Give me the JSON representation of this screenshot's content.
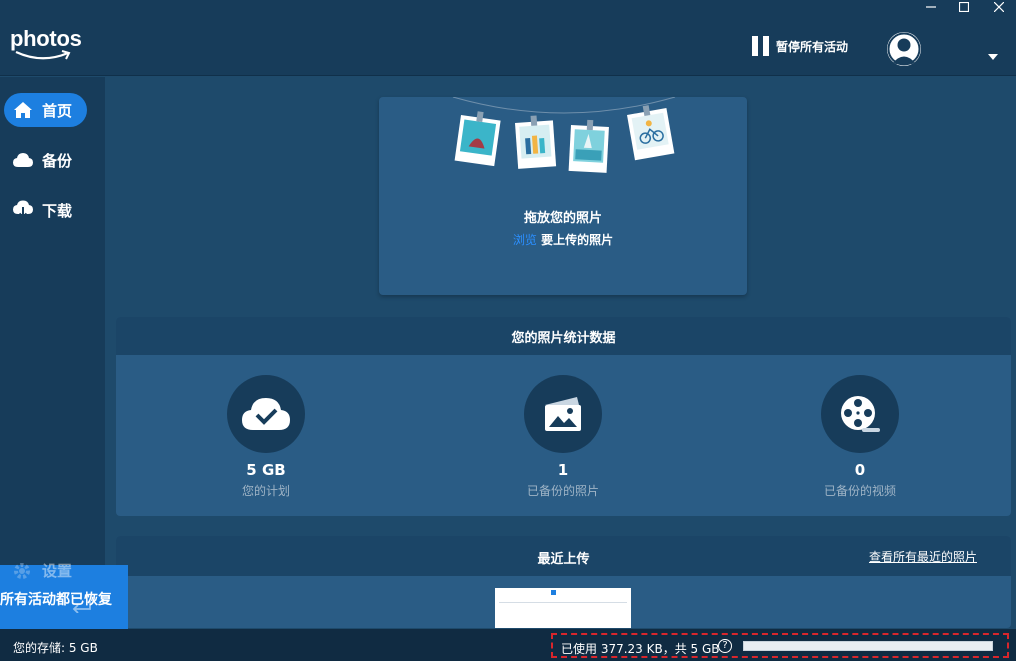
{
  "app": {
    "logo": "photos"
  },
  "header": {
    "pause_label": "暂停所有活动"
  },
  "sidebar": {
    "items": [
      {
        "label": "首页",
        "icon": "home-icon",
        "active": true
      },
      {
        "label": "备份",
        "icon": "cloud-icon",
        "active": false
      },
      {
        "label": "下载",
        "icon": "cloud-download-icon",
        "active": false
      }
    ],
    "settings_label": "设置"
  },
  "toast": {
    "text": "所有活动都已恢复"
  },
  "drop": {
    "title": "拖放您的照片",
    "browse_link": "浏览",
    "subtitle": "要上传的照片"
  },
  "stats": {
    "title": "您的照片统计数据",
    "items": [
      {
        "value": "5 GB",
        "label": "您的计划",
        "icon": "cloud-check-icon"
      },
      {
        "value": "1",
        "label": "已备份的照片",
        "icon": "photo-icon"
      },
      {
        "value": "0",
        "label": "已备份的视频",
        "icon": "film-reel-icon"
      }
    ]
  },
  "recent": {
    "title": "最近上传",
    "view_all": "查看所有最近的照片"
  },
  "footer": {
    "storage_label": "您的存储: 5 GB",
    "usage_text": "已使用 377.23 KB，共 5 GB",
    "help": "?",
    "usage_fraction": 7e-05
  },
  "colors": {
    "accent": "#1d7fe0",
    "background": "#1e4a6b",
    "panel": "#173c5a",
    "highlight_border": "#d9262c"
  }
}
